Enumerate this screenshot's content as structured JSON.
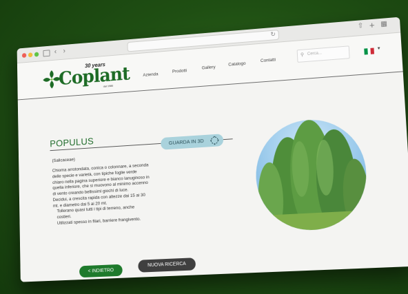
{
  "brand": {
    "years": "30 years",
    "name": "Coplant",
    "since": "dal 1986"
  },
  "menu": [
    "Azienda",
    "Prodotti",
    "Gallery",
    "Catalogo",
    "Contatti"
  ],
  "search": {
    "placeholder": "Cerca..."
  },
  "language": {
    "flag_colors": [
      "#009246",
      "#ffffff",
      "#ce2b37"
    ]
  },
  "product": {
    "title": "POPULUS",
    "family": "(Salicaceae)",
    "description": [
      "Chioma arrotondata, conica o colonnare, a seconda delle specie e varietà, con tipiche foglie verde chiaro nella pagina superiore e bianco lanuginoso in quella inferiore, che si muovono al minimo accenno di vento creando bellissimi giochi di luce.",
      "Decidui, a crescita rapida con altezze dai 15 ai 30 mt. e diametro dai 5 ai 20 mt.",
      "Tollerano quasi tutti i tipi di terreno, anche costieri.",
      "Utilizzati spesso in filari, barriere frangivento."
    ],
    "view3d_label": "GUARDA IN 3D"
  },
  "actions": {
    "back_label": "< INDIETRO",
    "new_search_label": "NUOVA RICERCA"
  },
  "colors": {
    "brand_green": "#1d6b25",
    "button_back": "#1e7a2c",
    "button_new": "#3f3f3f",
    "button_3d": "#a9d2dc"
  }
}
